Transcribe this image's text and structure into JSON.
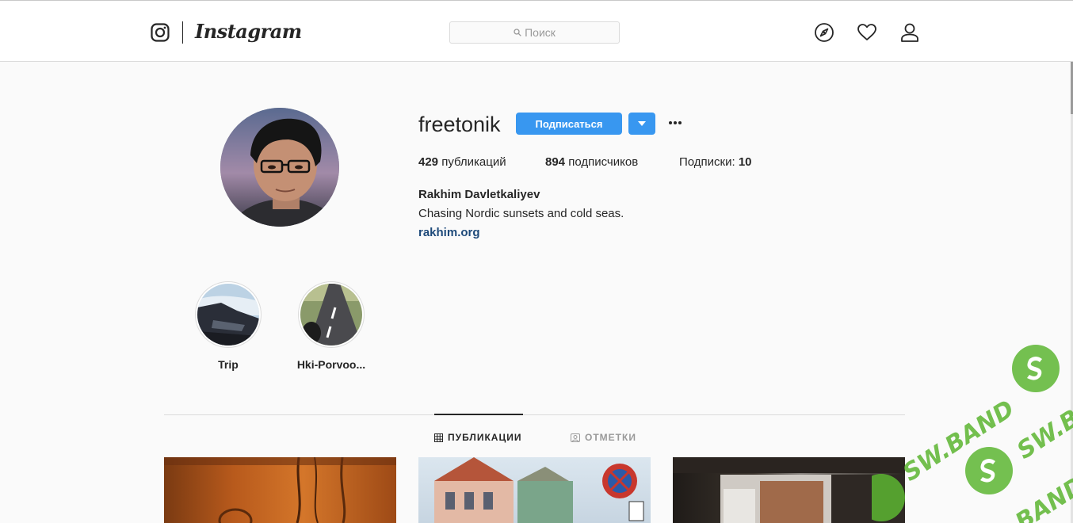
{
  "nav": {
    "wordmark": "Instagram",
    "search_placeholder": "Поиск",
    "icons": [
      "instagram-glyph-icon",
      "explore-compass-icon",
      "activity-heart-icon",
      "profile-person-icon"
    ]
  },
  "profile": {
    "username": "freetonik",
    "follow_label": "Подписаться",
    "stats": {
      "posts_count": "429",
      "posts_label": "публикаций",
      "followers_count": "894",
      "followers_label": "подписчиков",
      "following_label": "Подписки:",
      "following_count": "10"
    },
    "full_name": "Rakhim Davletkaliyev",
    "bio": "Chasing Nordic sunsets and cold seas.",
    "website": "rakhim.org"
  },
  "highlights": [
    {
      "label": "Trip"
    },
    {
      "label": "Hki-Porvoo..."
    }
  ],
  "tabs": [
    {
      "label": "ПУБЛИКАЦИИ",
      "active": true
    },
    {
      "label": "ОТМЕТКИ",
      "active": false
    }
  ],
  "colors": {
    "accent": "#3897f0",
    "link": "#1e4a7a",
    "watermark": "#5cb531"
  }
}
